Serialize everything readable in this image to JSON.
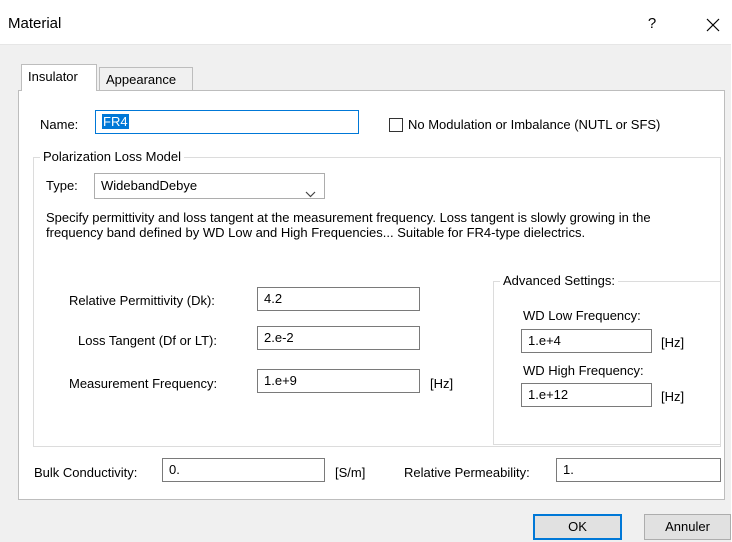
{
  "window": {
    "title": "Material",
    "help_label": "?",
    "close_icon": "close-icon"
  },
  "tabs": [
    {
      "label": "Insulator",
      "active": true
    },
    {
      "label": "Appearance",
      "active": false
    }
  ],
  "name_field": {
    "label": "Name:",
    "value": "FR4"
  },
  "no_modulation": {
    "label": "No Modulation or Imbalance (NUTL or SFS)",
    "checked": false
  },
  "polarization": {
    "legend": "Polarization Loss Model",
    "type_label": "Type:",
    "type_value": "WidebandDebye",
    "description": "Specify permittivity and loss tangent at the measurement frequency. Loss tangent is slowly growing in the frequency band defined by WD Low and High Frequencies... Suitable for FR4-type dielectrics."
  },
  "relative_permittivity": {
    "label": "Relative Permittivity (Dk):",
    "value": "4.2"
  },
  "loss_tangent": {
    "label": "Loss Tangent (Df or LT):",
    "value": "2.e-2"
  },
  "measurement_frequency": {
    "label": "Measurement Frequency:",
    "value": "1.e+9",
    "unit": "[Hz]"
  },
  "advanced": {
    "legend": "Advanced Settings:",
    "wd_low_label": "WD Low Frequency:",
    "wd_low_value": "1.e+4",
    "wd_low_unit": "[Hz]",
    "wd_high_label": "WD High Frequency:",
    "wd_high_value": "1.e+12",
    "wd_high_unit": "[Hz]"
  },
  "bulk_conductivity": {
    "label": "Bulk Conductivity:",
    "value": "0.",
    "unit": "[S/m]"
  },
  "relative_permeability": {
    "label": "Relative Permeability:",
    "value": "1."
  },
  "buttons": {
    "ok": "OK",
    "cancel": "Annuler"
  }
}
